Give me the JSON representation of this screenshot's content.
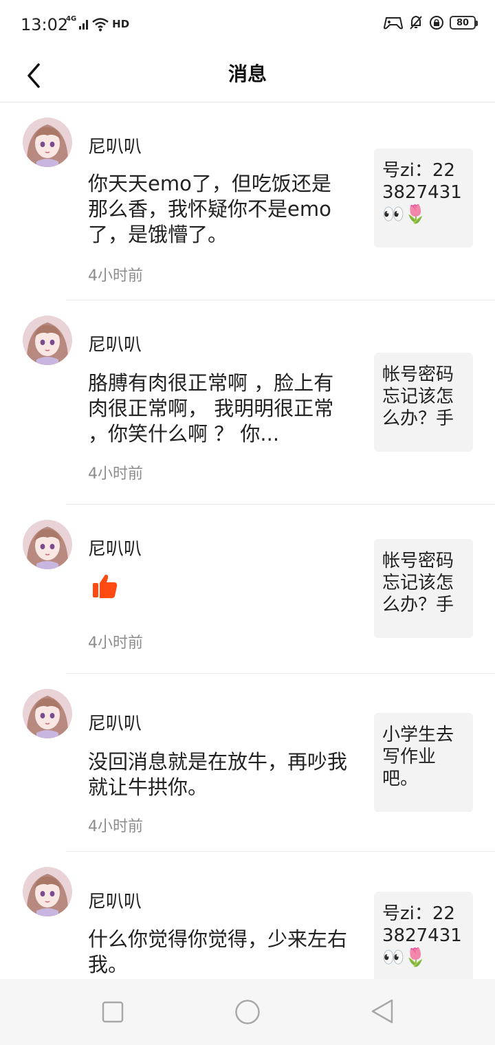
{
  "status_bar": {
    "time": "13:02",
    "network": "4G",
    "hd": "HD",
    "battery": "80"
  },
  "header": {
    "title": "消息"
  },
  "messages": [
    {
      "name": "尼叭叭",
      "text": "你天天emo了，但吃饭还是那么香，我怀疑你不是emo了，是饿懵了。",
      "time": "4小时前",
      "quote": "号zi：223827431👀🌷"
    },
    {
      "name": "尼叭叭",
      "text": "胳膊有肉很正常啊 ，脸上有肉很正常啊， 我明明很正常 ，你笑什么啊 ？ 你...",
      "time": "4小时前",
      "quote": "帐号密码忘记该怎么办？手"
    },
    {
      "name": "尼叭叭",
      "text": "",
      "sticker": "thumbs-up",
      "time": "4小时前",
      "quote": "帐号密码忘记该怎么办？手"
    },
    {
      "name": "尼叭叭",
      "text": "没回消息就是在放牛，再吵我就让牛拱你。",
      "time": "4小时前",
      "quote": "小学生去写作业吧。"
    },
    {
      "name": "尼叭叭",
      "text": "什么你觉得你觉得，少来左右我。",
      "time": "",
      "quote": "号zi：223827431👀🌷"
    }
  ],
  "nav": {
    "recent": "recent-apps-icon",
    "home": "home-icon",
    "back": "back-icon"
  },
  "colors": {
    "accent_thumb": "#ff4a12",
    "quote_bg": "#f3f3f3",
    "time_text": "#8c8c8c"
  }
}
